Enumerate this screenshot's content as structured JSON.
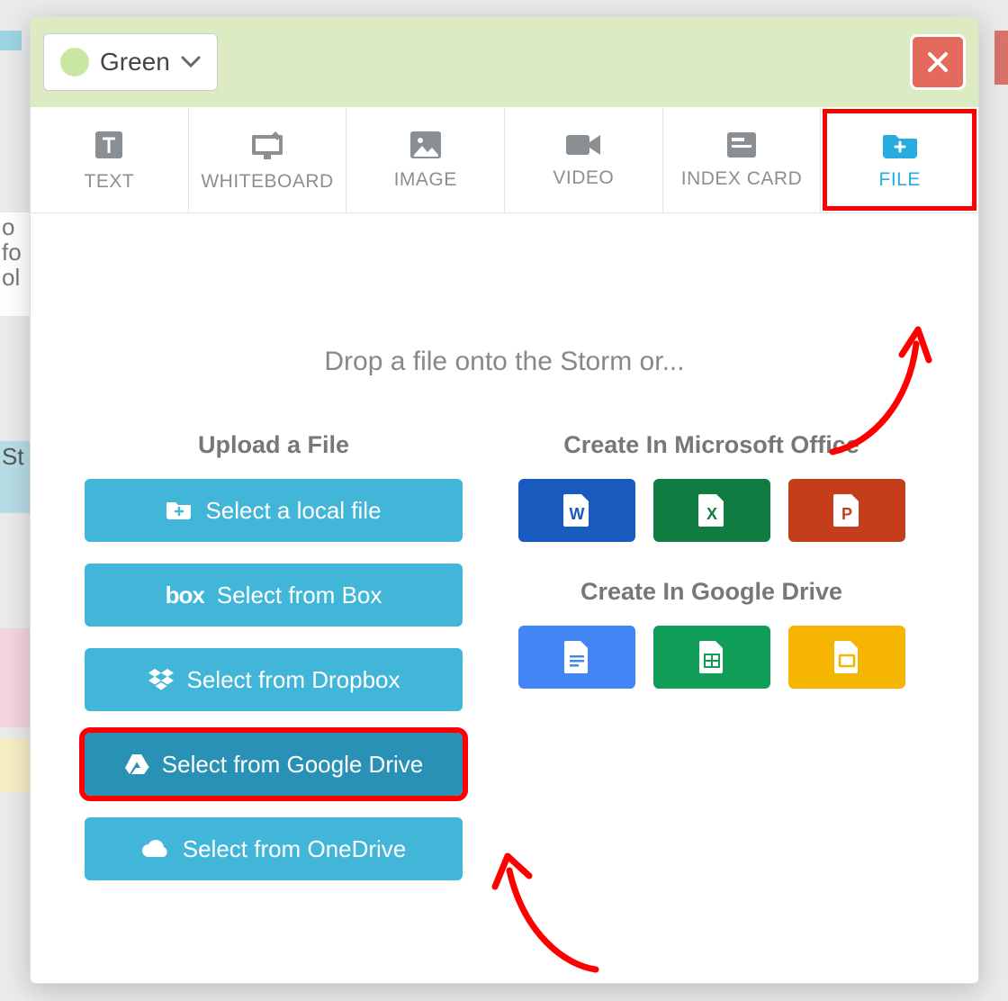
{
  "header": {
    "color_label": "Green",
    "close": "✕"
  },
  "tabs": [
    {
      "id": "text",
      "label": "TEXT"
    },
    {
      "id": "whiteboard",
      "label": "WHITEBOARD"
    },
    {
      "id": "image",
      "label": "IMAGE"
    },
    {
      "id": "video",
      "label": "VIDEO"
    },
    {
      "id": "index-card",
      "label": "INDEX CARD"
    },
    {
      "id": "file",
      "label": "FILE",
      "active": true,
      "highlighted": true
    }
  ],
  "body": {
    "drop_hint": "Drop a file onto the Storm or...",
    "upload_title": "Upload a File",
    "ms_title": "Create In Microsoft Office",
    "gd_title": "Create In Google Drive",
    "upload_buttons": {
      "local": "Select a local file",
      "box": "Select from Box",
      "dropbox": "Select from Dropbox",
      "gdrive": "Select from Google Drive",
      "onedrive": "Select from OneDrive"
    },
    "ms_apps": [
      "word",
      "excel",
      "powerpoint"
    ],
    "gd_apps": [
      "docs",
      "sheets",
      "slides"
    ]
  }
}
